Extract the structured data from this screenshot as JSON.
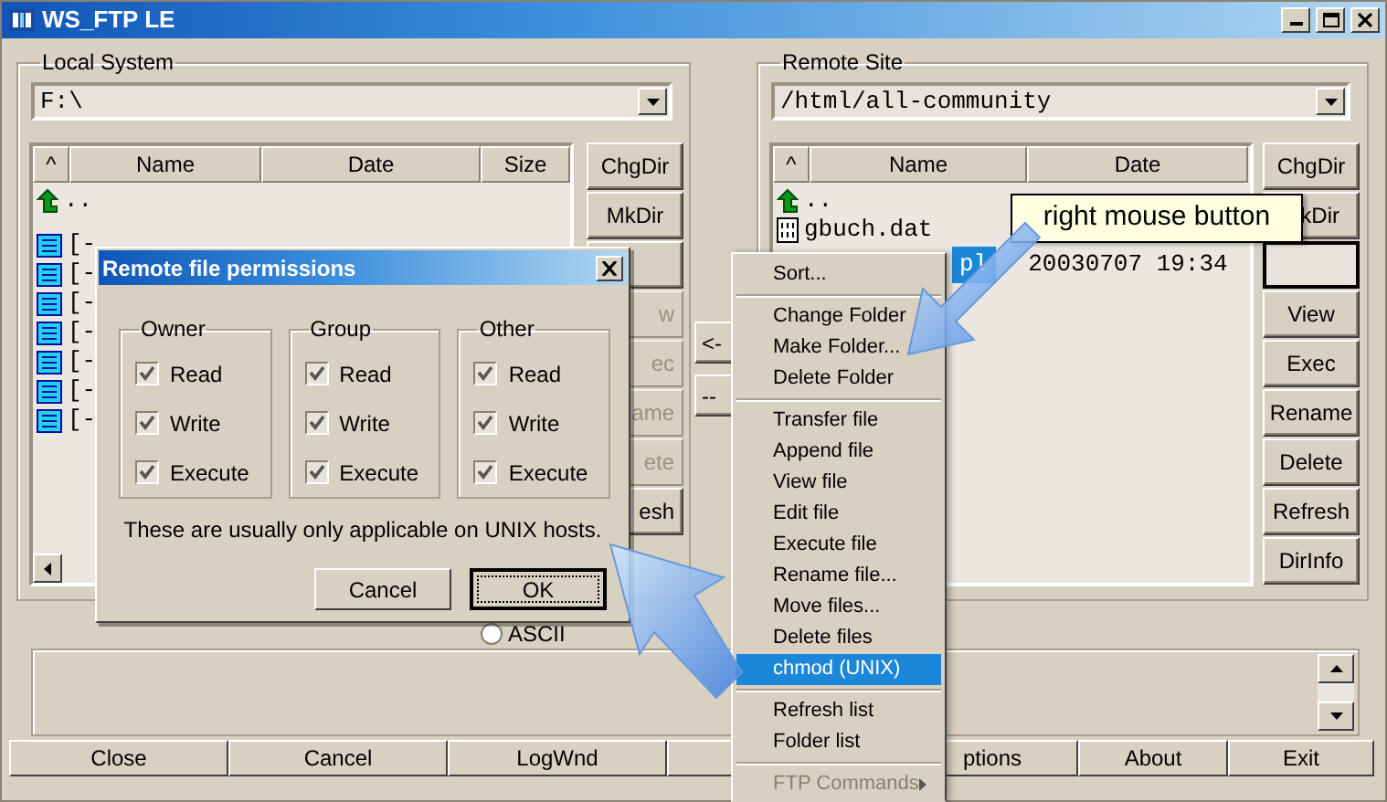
{
  "window": {
    "title": "WS_FTP LE"
  },
  "local": {
    "title": "Local System",
    "path": "F:\\",
    "columns": [
      "^",
      "Name",
      "Date",
      "Size"
    ],
    "rows": [
      {
        "kind": "up",
        "name": ".."
      },
      {
        "kind": "drive",
        "name": "[-"
      },
      {
        "kind": "drive",
        "name": "[-"
      },
      {
        "kind": "drive",
        "name": "[-"
      },
      {
        "kind": "drive",
        "name": "[-"
      },
      {
        "kind": "drive",
        "name": "[-"
      },
      {
        "kind": "drive",
        "name": "[-"
      },
      {
        "kind": "drive",
        "name": "[-"
      }
    ],
    "buttons": [
      {
        "kind": "text",
        "label": "ChgDir",
        "disabled": false
      },
      {
        "kind": "text",
        "label": "MkDir",
        "disabled": false
      },
      {
        "kind": "blank",
        "disabled": false
      },
      {
        "kind": "text",
        "label": "w",
        "disabled": true
      },
      {
        "kind": "text",
        "label": "ec",
        "disabled": true
      },
      {
        "kind": "text",
        "label": "ame",
        "disabled": true
      },
      {
        "kind": "text",
        "label": "ete",
        "disabled": true
      },
      {
        "kind": "text",
        "label": "esh",
        "disabled": false
      }
    ]
  },
  "transfer": [
    {
      "label": "<-"
    },
    {
      "label": "--"
    }
  ],
  "mode": {
    "label": "ASCII",
    "selected": false
  },
  "remote": {
    "title": "Remote Site",
    "path": "/html/all-community",
    "columns": [
      "^",
      "Name",
      "Date"
    ],
    "rows": [
      {
        "kind": "up",
        "name": "..",
        "selected": false
      },
      {
        "kind": "file",
        "name": "gbuch.dat",
        "selected": false
      },
      {
        "name": "pl",
        "date": "20030707 19:34",
        "selected": true
      }
    ],
    "buttons": [
      {
        "kind": "text",
        "label": "ChgDir",
        "focused": false
      },
      {
        "kind": "text",
        "label": "kDir",
        "focused": false
      },
      {
        "kind": "blank",
        "focused": true
      },
      {
        "kind": "text",
        "label": "View",
        "focused": false
      },
      {
        "kind": "text",
        "label": "Exec",
        "focused": false
      },
      {
        "kind": "text",
        "label": "Rename",
        "focused": false
      },
      {
        "kind": "text",
        "label": "Delete",
        "focused": false
      },
      {
        "kind": "text",
        "label": "Refresh",
        "focused": false
      },
      {
        "kind": "text",
        "label": "DirInfo",
        "focused": false
      }
    ]
  },
  "bottom_buttons": [
    {
      "label": "Close"
    },
    {
      "label": "Cancel"
    },
    {
      "label": "LogWnd"
    },
    {
      "label": "ptions"
    },
    {
      "label": "About"
    },
    {
      "label": "Exit"
    }
  ],
  "dialog": {
    "title": "Remote file permissions",
    "groups": [
      {
        "title": "Owner",
        "checks": [
          {
            "label": "Read",
            "checked": true
          },
          {
            "label": "Write",
            "checked": true
          },
          {
            "label": "Execute",
            "checked": true
          }
        ]
      },
      {
        "title": "Group",
        "checks": [
          {
            "label": "Read",
            "checked": true
          },
          {
            "label": "Write",
            "checked": true
          },
          {
            "label": "Execute",
            "checked": true
          }
        ]
      },
      {
        "title": "Other",
        "checks": [
          {
            "label": "Read",
            "checked": true
          },
          {
            "label": "Write",
            "checked": true
          },
          {
            "label": "Execute",
            "checked": true
          }
        ]
      }
    ],
    "note": "These are usually only applicable on UNIX hosts.",
    "buttons": [
      {
        "label": "Cancel",
        "default": false
      },
      {
        "label": "OK",
        "default": true
      }
    ]
  },
  "context_menu": [
    {
      "kind": "item",
      "label": "Sort...",
      "selected": false
    },
    {
      "kind": "separator"
    },
    {
      "kind": "item",
      "label": "Change Folder",
      "selected": false
    },
    {
      "kind": "item",
      "label": "Make Folder...",
      "selected": false
    },
    {
      "kind": "item",
      "label": "Delete Folder",
      "selected": false
    },
    {
      "kind": "separator"
    },
    {
      "kind": "item",
      "label": "Transfer file",
      "selected": false
    },
    {
      "kind": "item",
      "label": "Append file",
      "selected": false
    },
    {
      "kind": "item",
      "label": "View file",
      "selected": false
    },
    {
      "kind": "item",
      "label": "Edit file",
      "selected": false
    },
    {
      "kind": "item",
      "label": "Execute file",
      "selected": false
    },
    {
      "kind": "item",
      "label": "Rename file...",
      "selected": false
    },
    {
      "kind": "item",
      "label": "Move files...",
      "selected": false
    },
    {
      "kind": "item",
      "label": "Delete files",
      "selected": false
    },
    {
      "kind": "item",
      "label": "chmod (UNIX)",
      "selected": true
    },
    {
      "kind": "separator"
    },
    {
      "kind": "item",
      "label": "Refresh list",
      "selected": false
    },
    {
      "kind": "item",
      "label": "Folder list",
      "selected": false
    },
    {
      "kind": "separator"
    },
    {
      "kind": "submenu",
      "label": "FTP Commands",
      "selected": false
    }
  ],
  "tooltip": {
    "text": "right mouse button"
  }
}
